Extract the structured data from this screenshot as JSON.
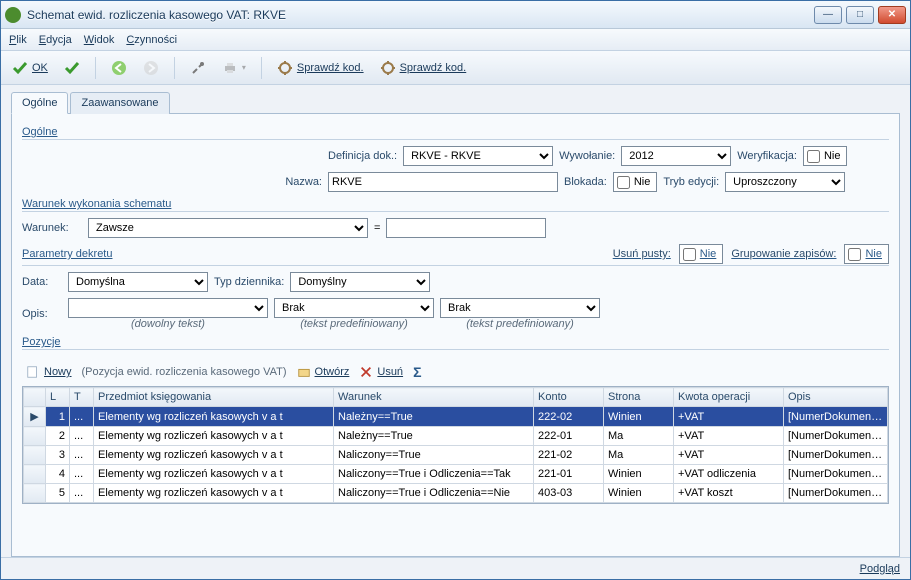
{
  "title": "Schemat ewid. rozliczenia kasowego VAT: RKVE",
  "menu": {
    "plik": "Plik",
    "edycja": "Edycja",
    "widok": "Widok",
    "czynnosci": "Czynności"
  },
  "toolbar": {
    "ok": "OK",
    "check1": "Sprawdź kod.",
    "check2": "Sprawdź kod."
  },
  "tabs": {
    "general": "Ogólne",
    "advanced": "Zaawansowane"
  },
  "general": {
    "section": "Ogólne",
    "defLabel": "Definicja dok.:",
    "defValue": "RKVE - RKVE",
    "callLabel": "Wywołanie:",
    "callValue": "2012",
    "verifyLabel": "Weryfikacja:",
    "verifyText": "Nie",
    "nameLabel": "Nazwa:",
    "nameValue": "RKVE",
    "lockLabel": "Blokada:",
    "lockText": "Nie",
    "editLabel": "Tryb edycji:",
    "editValue": "Uproszczony"
  },
  "cond": {
    "section": "Warunek wykonania schematu",
    "label": "Warunek:",
    "value": "Zawsze",
    "eq": "="
  },
  "params": {
    "section": "Parametry dekretu",
    "emptyLabel": "Usuń pusty:",
    "emptyText": "Nie",
    "groupLabel": "Grupowanie zapisów:",
    "groupText": "Nie",
    "dateLabel": "Data:",
    "dateValue": "Domyślna",
    "journalLabel": "Typ dziennika:",
    "journalValue": "Domyślny",
    "descLabel": "Opis:",
    "desc2": "Brak",
    "desc3": "Brak",
    "hint1": "(dowolny tekst)",
    "hint2": "(tekst predefiniowany)",
    "hint3": "(tekst predefiniowany)"
  },
  "positions": {
    "section": "Pozycje",
    "new": "Nowy",
    "newHint": "(Pozycja ewid. rozliczenia kasowego VAT)",
    "open": "Otwórz",
    "del": "Usuń",
    "cols": {
      "l": "L",
      "t": "T",
      "subject": "Przedmiot księgowania",
      "cond": "Warunek",
      "account": "Konto",
      "side": "Strona",
      "amount": "Kwota operacji",
      "desc": "Opis"
    },
    "rows": [
      {
        "l": "1",
        "t": "...",
        "subject": "Elementy wg rozliczeń kasowych v a t",
        "cond": "Należny==True",
        "account": "222-02",
        "side": "Winien",
        "amount": "+VAT",
        "desc": "[NumerDokumentu]"
      },
      {
        "l": "2",
        "t": "...",
        "subject": "Elementy wg rozliczeń kasowych v a t",
        "cond": "Należny==True",
        "account": "222-01",
        "side": "Ma",
        "amount": "+VAT",
        "desc": "[NumerDokumentu]"
      },
      {
        "l": "3",
        "t": "...",
        "subject": "Elementy wg rozliczeń kasowych v a t",
        "cond": "Naliczony==True",
        "account": "221-02",
        "side": "Ma",
        "amount": "+VAT",
        "desc": "[NumerDokumentu]"
      },
      {
        "l": "4",
        "t": "...",
        "subject": "Elementy wg rozliczeń kasowych v a t",
        "cond": "Naliczony==True i Odliczenia==Tak",
        "account": "221-01",
        "side": "Winien",
        "amount": "+VAT odliczenia",
        "desc": "[NumerDokumentu]"
      },
      {
        "l": "5",
        "t": "...",
        "subject": "Elementy wg rozliczeń kasowych v a t",
        "cond": "Naliczony==True i Odliczenia==Nie",
        "account": "403-03",
        "side": "Winien",
        "amount": "+VAT koszt",
        "desc": "[NumerDokumentu]"
      }
    ]
  },
  "status": {
    "preview": "Podgląd"
  }
}
